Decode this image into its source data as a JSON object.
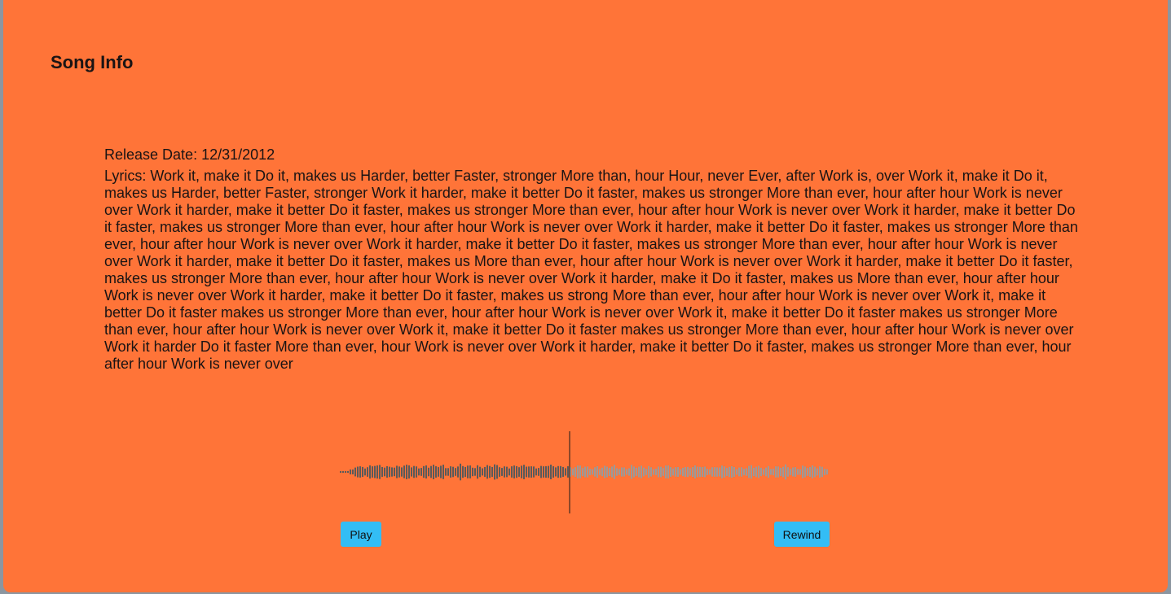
{
  "page": {
    "title": "Song Info"
  },
  "song": {
    "release_date": "Release Date: 12/31/2012",
    "lyrics": "Lyrics: Work it, make it Do it, makes us Harder, better Faster, stronger More than, hour Hour, never Ever, after Work is, over Work it, make it Do it, makes us Harder, better Faster, stronger Work it harder, make it better Do it faster, makes us stronger More than ever, hour after hour Work is never over Work it harder, make it better Do it faster, makes us stronger More than ever, hour after hour Work is never over Work it harder, make it better Do it faster, makes us stronger More than ever, hour after hour Work is never over Work it harder, make it better Do it faster, makes us stronger More than ever, hour after hour Work is never over Work it harder, make it better Do it faster, makes us stronger More than ever, hour after hour Work is never over Work it harder, make it better Do it faster, makes us More than ever, hour after hour Work is never over Work it harder, make it better Do it faster, makes us stronger More than ever, hour after hour Work is never over Work it harder, make it Do it faster, makes us More than ever, hour after hour Work is never over Work it harder, make it better Do it faster, makes us strong More than ever, hour after hour Work is never over Work it, make it better Do it faster makes us stronger More than ever, hour after hour Work is never over Work it, make it better Do it faster makes us stronger More than ever, hour after hour Work is never over Work it, make it better Do it faster makes us stronger More than ever, hour after hour Work is never over Work it harder Do it faster More than ever, hour Work is never over Work it harder, make it better Do it faster, makes us stronger More than ever, hour after hour Work is never over"
  },
  "player": {
    "progress": 0.47,
    "played_color": "#5a5a5a",
    "unplayed_color": "#9a9a9a",
    "cursor_color": "#1a1a1a",
    "play_label": "Play",
    "rewind_label": "Rewind"
  },
  "colors": {
    "background": "#ff7438",
    "button": "#33bdf5"
  }
}
